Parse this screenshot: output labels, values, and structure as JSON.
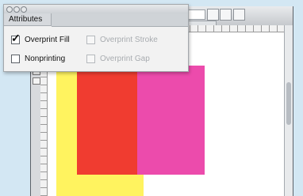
{
  "panel": {
    "tab_label": "Attributes",
    "options": [
      {
        "label": "Overprint Fill",
        "checked": true,
        "enabled": true
      },
      {
        "label": "Overprint Stroke",
        "checked": false,
        "enabled": false
      },
      {
        "label": "Nonprinting",
        "checked": false,
        "enabled": true
      },
      {
        "label": "Overprint Gap",
        "checked": false,
        "enabled": false
      }
    ]
  },
  "icons": {
    "checkmark": "✓",
    "panel_controls": "window-control-icon"
  },
  "colors": {
    "background": "#d3e7f3",
    "yellow_shape": "#fff35f",
    "red_shape": "#f03c30",
    "pink_shape": "#ec4bac"
  }
}
